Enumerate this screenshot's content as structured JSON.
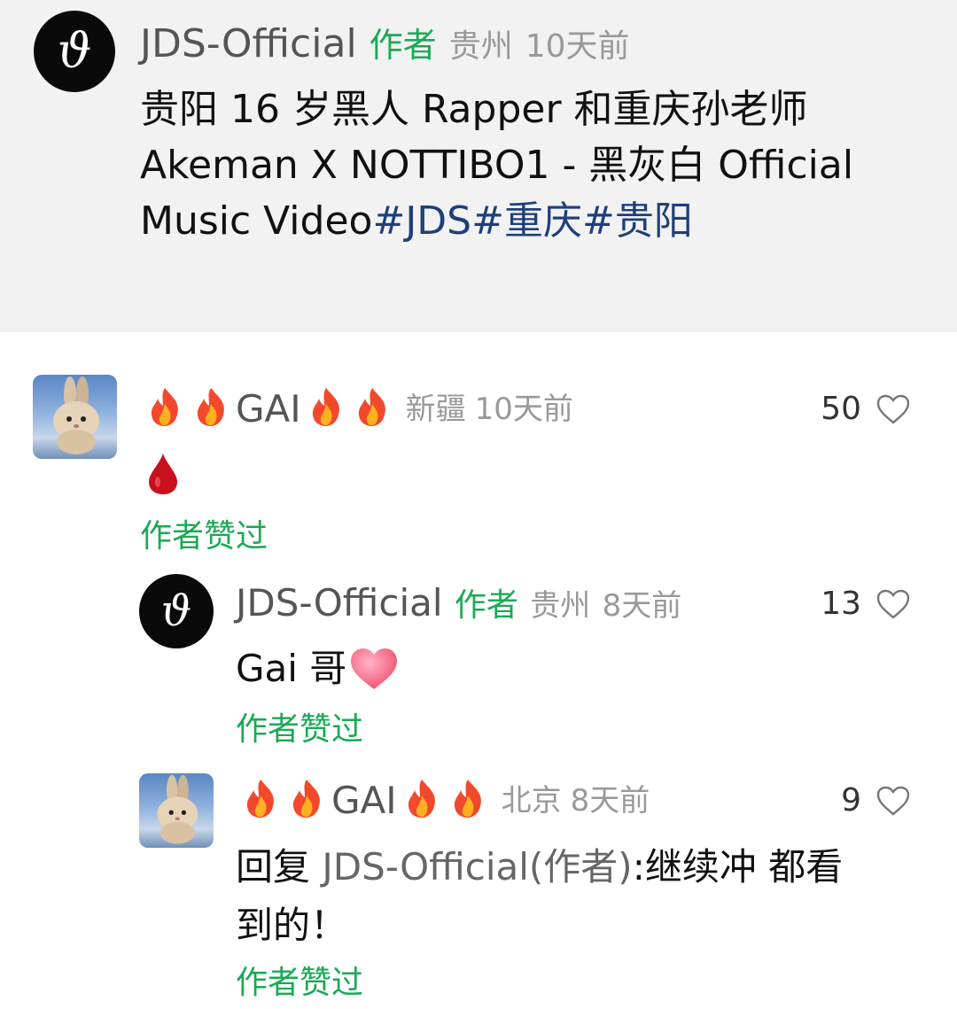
{
  "post": {
    "author": "JDS-Official",
    "author_tag": "作者",
    "location": "贵州",
    "time": "10天前",
    "text_line1": "贵阳 16 岁黑人 Rapper 和重庆孙老师",
    "text_line2": "Akeman X NOTTIBO1 - 黑灰白 Official",
    "text_line3_prefix": "Music Video",
    "hashtags": [
      "#JDS",
      "#重庆",
      "#贵阳"
    ]
  },
  "comments": [
    {
      "user": "GAI",
      "location": "新疆",
      "time": "10天前",
      "text": "🩸",
      "likes": "50",
      "liked_by_author": "作者赞过"
    },
    {
      "user": "JDS-Official",
      "author_tag": "作者",
      "location": "贵州",
      "time": "8天前",
      "text": "Gai 哥",
      "likes": "13",
      "liked_by_author": "作者赞过"
    },
    {
      "user": "GAI",
      "location": "北京",
      "time": "8天前",
      "text_prefix": "回复 ",
      "reply_target": "JDS-Official(作者)",
      "text_line1_rest": ":继续冲 都看",
      "text_line2": "到的！",
      "likes": "9",
      "liked_by_author": "作者赞过"
    }
  ],
  "icons": {
    "heart": "heart-outline-icon",
    "fire": "fire-emoji",
    "blood": "blood-drop-emoji",
    "heart_emoji": "pink-heart-emoji",
    "avatar_jds": "jds-monogram-logo",
    "avatar_gai": "bunny-photo-avatar"
  },
  "colors": {
    "author_tag": "#1aaa55",
    "hashtag": "#1f3f7a",
    "meta": "#999999",
    "header_bg": "#f2f2f2"
  }
}
